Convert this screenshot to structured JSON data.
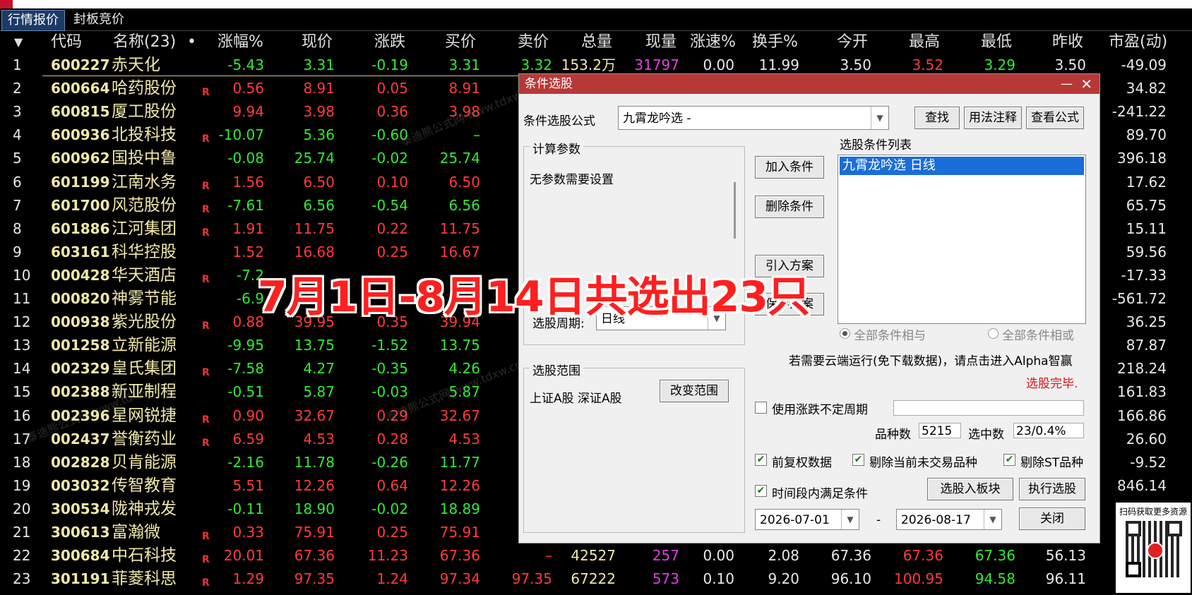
{
  "tabs": [
    {
      "label": "行情报价"
    },
    {
      "label": "封板竞价"
    }
  ],
  "header": {
    "sort_arrow": "▼",
    "code": "代码",
    "name": "名称(23)",
    "dot": "•",
    "change_pct": "涨幅%",
    "price": "现价",
    "change": "涨跌",
    "bid": "买价",
    "ask": "卖价",
    "volume": "总量",
    "cur_vol": "现量",
    "speed": "涨速%",
    "turnover": "换手%",
    "open": "今开",
    "high": "最高",
    "low": "最低",
    "prev_close": "昨收",
    "pe": "市盈(动)"
  },
  "rows": [
    {
      "idx": "1",
      "code": "600227",
      "name": "赤天化",
      "r": "",
      "pct": "-5.43",
      "price": "3.31",
      "chg": "-0.19",
      "bid": "3.31",
      "ask": "3.32",
      "vol": "153.2万",
      "cur": "31797",
      "speed": "0.00",
      "turn": "11.99",
      "open": "3.50",
      "high": "3.52",
      "low": "3.29",
      "prev": "3.50",
      "pe": "-49.09"
    },
    {
      "idx": "2",
      "code": "600664",
      "name": "哈药股份",
      "r": "R",
      "pct": "0.56",
      "price": "8.91",
      "chg": "0.05",
      "bid": "8.91",
      "pe": "34.82"
    },
    {
      "idx": "3",
      "code": "600815",
      "name": "厦工股份",
      "r": "",
      "pct": "9.94",
      "price": "3.98",
      "chg": "0.36",
      "bid": "3.98",
      "pe": "-241.22"
    },
    {
      "idx": "4",
      "code": "600936",
      "name": "北投科技",
      "r": "R",
      "pct": "-10.07",
      "price": "5.36",
      "chg": "-0.60",
      "bid": "–",
      "pe": "89.70"
    },
    {
      "idx": "5",
      "code": "600962",
      "name": "国投中鲁",
      "r": "",
      "pct": "-0.08",
      "price": "25.74",
      "chg": "-0.02",
      "bid": "25.74",
      "pe": "396.18"
    },
    {
      "idx": "6",
      "code": "601199",
      "name": "江南水务",
      "r": "R",
      "pct": "1.56",
      "price": "6.50",
      "chg": "0.10",
      "bid": "6.50",
      "pe": "17.62"
    },
    {
      "idx": "7",
      "code": "601700",
      "name": "风范股份",
      "r": "R",
      "pct": "-7.61",
      "price": "6.56",
      "chg": "-0.54",
      "bid": "6.56",
      "pe": "65.75"
    },
    {
      "idx": "8",
      "code": "601886",
      "name": "江河集团",
      "r": "R",
      "pct": "1.91",
      "price": "11.75",
      "chg": "0.22",
      "bid": "11.75",
      "pe": "15.11"
    },
    {
      "idx": "9",
      "code": "603161",
      "name": "科华控股",
      "r": "",
      "pct": "1.52",
      "price": "16.68",
      "chg": "0.25",
      "bid": "16.67",
      "pe": "59.56"
    },
    {
      "idx": "10",
      "code": "000428",
      "name": "华天酒店",
      "r": "R",
      "pct": "-7.2",
      "price": "",
      "chg": "",
      "bid": "",
      "pe": "-17.33"
    },
    {
      "idx": "11",
      "code": "000820",
      "name": "神雾节能",
      "r": "",
      "pct": "-6.9",
      "price": "",
      "chg": "",
      "bid": "",
      "pe": "-561.72"
    },
    {
      "idx": "12",
      "code": "000938",
      "name": "紫光股份",
      "r": "R",
      "pct": "0.88",
      "price": "39.95",
      "chg": "0.35",
      "bid": "39.94",
      "pe": "36.25"
    },
    {
      "idx": "13",
      "code": "001258",
      "name": "立新能源",
      "r": "",
      "pct": "-9.95",
      "price": "13.75",
      "chg": "-1.52",
      "bid": "13.75",
      "pe": "87.87"
    },
    {
      "idx": "14",
      "code": "002329",
      "name": "皇氏集团",
      "r": "R",
      "pct": "-7.58",
      "price": "4.27",
      "chg": "-0.35",
      "bid": "4.26",
      "pe": "218.24"
    },
    {
      "idx": "15",
      "code": "002388",
      "name": "新亚制程",
      "r": "",
      "pct": "-0.51",
      "price": "5.87",
      "chg": "-0.03",
      "bid": "5.87",
      "pe": "161.83"
    },
    {
      "idx": "16",
      "code": "002396",
      "name": "星网锐捷",
      "r": "R",
      "pct": "0.90",
      "price": "32.67",
      "chg": "0.29",
      "bid": "32.67",
      "pe": "166.86"
    },
    {
      "idx": "17",
      "code": "002437",
      "name": "誉衡药业",
      "r": "R",
      "pct": "6.59",
      "price": "4.53",
      "chg": "0.28",
      "bid": "4.53",
      "pe": "26.60"
    },
    {
      "idx": "18",
      "code": "002828",
      "name": "贝肯能源",
      "r": "",
      "pct": "-2.16",
      "price": "11.78",
      "chg": "-0.26",
      "bid": "11.77",
      "pe": "-9.52"
    },
    {
      "idx": "19",
      "code": "003032",
      "name": "传智教育",
      "r": "",
      "pct": "5.51",
      "price": "12.26",
      "chg": "0.64",
      "bid": "12.26",
      "pe": "846.14"
    },
    {
      "idx": "20",
      "code": "300534",
      "name": "陇神戎发",
      "r": "",
      "pct": "-0.11",
      "price": "18.90",
      "chg": "-0.02",
      "bid": "18.89",
      "pe": ""
    },
    {
      "idx": "21",
      "code": "300613",
      "name": "富瀚微",
      "r": "R",
      "pct": "0.33",
      "price": "75.91",
      "chg": "0.25",
      "bid": "75.91",
      "pe": ""
    },
    {
      "idx": "22",
      "code": "300684",
      "name": "中石科技",
      "r": "R",
      "pct": "20.01",
      "price": "67.36",
      "chg": "11.23",
      "bid": "67.36",
      "ask": "–",
      "vol": "42527",
      "cur": "257",
      "speed": "0.00",
      "turn": "2.08",
      "open": "67.36",
      "high": "67.36",
      "low": "67.36",
      "prev": "56.13",
      "pe": ""
    },
    {
      "idx": "23",
      "code": "301191",
      "name": "菲菱科思",
      "r": "R",
      "pct": "1.29",
      "price": "97.35",
      "chg": "1.24",
      "bid": "97.34",
      "ask": "97.35",
      "vol": "67222",
      "cur": "573",
      "speed": "0.10",
      "turn": "9.20",
      "open": "96.10",
      "high": "100.95",
      "low": "94.58",
      "prev": "96.11",
      "pe": ""
    }
  ],
  "overlay": {
    "title": "7月1日-8月14日共选出23只"
  },
  "dialog": {
    "title": "条件选股",
    "min": "—",
    "close": "✕",
    "formula_label": "条件选股公式",
    "formula_value": "九霄龙吟选  -",
    "find_btn": "查找",
    "usage_btn": "用法注释",
    "view_btn": "查看公式",
    "params_group": "计算参数",
    "params_text": "无参数需要设置",
    "period_label": "选股周期:",
    "period_value": "日线",
    "add_btn": "加入条件",
    "del_btn": "删除条件",
    "import_btn": "引入方案",
    "save_btn": "保存方案",
    "list_label": "选股条件列表",
    "list_item": "九霄龙吟选  日线",
    "radio_and": "全部条件相与",
    "radio_or": "全部条件相或",
    "cloud_text": "若需要云端运行(免下载数据)，请点击进入Alpha智赢",
    "done_text": "选股完毕.",
    "range_group": "选股范围",
    "range_text": "上证A股 深证A股",
    "change_range_btn": "改变范围",
    "use_uncertain": "使用涨跌不定周期",
    "count_label": "品种数",
    "count_value": "5215",
    "selected_label": "选中数",
    "selected_value": "23/0.4%",
    "chk_forward": "前复权数据",
    "chk_exclude_notrade": "剔除当前未交易品种",
    "chk_exclude_st": "剔除ST品种",
    "chk_timerange": "时间段内满足条件",
    "to_block_btn": "选股入板块",
    "run_btn": "执行选股",
    "date_from": "2026-07-01",
    "date_sep": "-",
    "date_to": "2026-08-17",
    "close_btn": "关闭"
  },
  "qr": {
    "text": "扫码获取更多资源"
  },
  "colors": {
    "up": "#ff3b3b",
    "down": "#34e834",
    "title_bar": "#b83838",
    "selection": "#1a6ed8"
  }
}
